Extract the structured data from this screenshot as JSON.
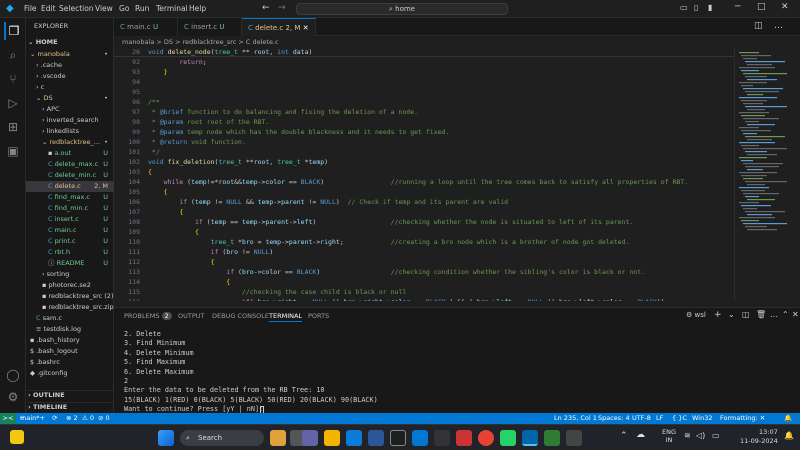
{
  "titlebar": {
    "menus": [
      "File",
      "Edit",
      "Selection",
      "View",
      "Go",
      "Run",
      "Terminal",
      "Help"
    ],
    "search_text": "home"
  },
  "explorer": {
    "header": "EXPLORER",
    "root": "HOME",
    "items": [
      {
        "label": "manobala",
        "badge": "•",
        "color": "#e2c08d"
      },
      {
        "label": ".cache",
        "badge": "",
        "color": "#ccc"
      },
      {
        "label": ".vscode",
        "badge": "",
        "color": "#ccc"
      },
      {
        "label": "c",
        "badge": "",
        "color": "#ccc"
      },
      {
        "label": "DS",
        "badge": "•",
        "color": "#e2c08d"
      },
      {
        "label": "APC",
        "badge": "",
        "color": "#ccc"
      },
      {
        "label": "inverted_search",
        "badge": "",
        "color": "#ccc"
      },
      {
        "label": "linkedlists",
        "badge": "",
        "color": "#ccc"
      },
      {
        "label": "redblacktree_...",
        "badge": "•",
        "color": "#e2c08d"
      },
      {
        "label": "a.out",
        "badge": "U",
        "color": "#73c991"
      },
      {
        "label": "delete_max.c",
        "badge": "U",
        "color": "#73c991"
      },
      {
        "label": "delete_min.c",
        "badge": "U",
        "color": "#73c991"
      },
      {
        "label": "delete.c",
        "badge": "2, M",
        "color": "#e2c08d"
      },
      {
        "label": "find_max.c",
        "badge": "U",
        "color": "#73c991"
      },
      {
        "label": "find_min.c",
        "badge": "U",
        "color": "#73c991"
      },
      {
        "label": "insert.c",
        "badge": "U",
        "color": "#73c991"
      },
      {
        "label": "main.c",
        "badge": "U",
        "color": "#73c991"
      },
      {
        "label": "print.c",
        "badge": "U",
        "color": "#73c991"
      },
      {
        "label": "rbt.h",
        "badge": "U",
        "color": "#73c991"
      },
      {
        "label": "README",
        "badge": "U",
        "color": "#73c991"
      },
      {
        "label": "sorting",
        "badge": "",
        "color": "#ccc"
      },
      {
        "label": "photorec.se2",
        "badge": "",
        "color": "#ccc"
      },
      {
        "label": "redblacktree_src (2)...",
        "badge": "",
        "color": "#ccc"
      },
      {
        "label": "redblacktree_src.zip",
        "badge": "",
        "color": "#ccc"
      },
      {
        "label": "sam.c",
        "badge": "",
        "color": "#ccc"
      },
      {
        "label": "testdisk.log",
        "badge": "",
        "color": "#ccc"
      },
      {
        "label": ".bash_history",
        "badge": "",
        "color": "#ccc"
      },
      {
        "label": ".bash_logout",
        "badge": "",
        "color": "#ccc"
      },
      {
        "label": ".bashrc",
        "badge": "",
        "color": "#ccc"
      },
      {
        "label": ".gitconfig",
        "badge": "",
        "color": "#ccc"
      }
    ],
    "outline": "OUTLINE",
    "timeline": "TIMELINE"
  },
  "tabs": [
    {
      "label": "main.c",
      "badge": "U",
      "active": false
    },
    {
      "label": "insert.c",
      "badge": "U",
      "active": false
    },
    {
      "label": "delete.c",
      "badge": "2, M",
      "active": true
    }
  ],
  "breadcrumb": "manobala > DS > redblacktree_src > C delete.c",
  "editor": {
    "sticky": {
      "ln": "26",
      "text": "void delete_node(tree_t ** root, int data)"
    },
    "lines": [
      {
        "ln": "92",
        "code": "        return;"
      },
      {
        "ln": "93",
        "code": "    }"
      },
      {
        "ln": "94",
        "code": ""
      },
      {
        "ln": "95",
        "code": ""
      },
      {
        "ln": "96",
        "code": "/**"
      },
      {
        "ln": "97",
        "code": " * @brief function to do balancing and fixing the deletion of a node."
      },
      {
        "ln": "98",
        "code": " * @param root root of the RBT."
      },
      {
        "ln": "99",
        "code": " * @param temp node which has the double blackness and it needs to get fixed."
      },
      {
        "ln": "100",
        "code": " * @return void function."
      },
      {
        "ln": "101",
        "code": " */"
      },
      {
        "ln": "102",
        "code": "void fix_deletion(tree_t **root, tree_t *temp)"
      },
      {
        "ln": "103",
        "code": "{"
      },
      {
        "ln": "104",
        "code": "    while (temp!=*root&&temp->color == BLACK)                 //running a loop until the tree comes back to satisfy all properties of RBT."
      },
      {
        "ln": "105",
        "code": "    {"
      },
      {
        "ln": "106",
        "code": "        if (temp != NULL && temp->parent != NULL)  // Check if temp and its parent are valid"
      },
      {
        "ln": "107",
        "code": "        {"
      },
      {
        "ln": "108",
        "code": "            if (temp == temp->parent->left)                   //checking whether the node is situated to left of its parent."
      },
      {
        "ln": "109",
        "code": "            {"
      },
      {
        "ln": "110",
        "code": "                tree_t *bro = temp->parent->right;            //creating a bro node which is a brother of node got deleted."
      },
      {
        "ln": "111",
        "code": "                if (bro != NULL)"
      },
      {
        "ln": "112",
        "code": "                {"
      },
      {
        "ln": "113",
        "code": "                    if (bro->color == BLACK)                  //checking condition whether the sibling's color is black or not."
      },
      {
        "ln": "114",
        "code": "                    {"
      },
      {
        "ln": "115",
        "code": "                        //checking the case child is black or null"
      },
      {
        "ln": "116",
        "code": "                        if( bro->right == NULL || bro->right->color == BLACK ) && ( bro->left == NULL || bro->left->color == BLACK))"
      }
    ]
  },
  "panel": {
    "tabs": [
      "PROBLEMS",
      "OUTPUT",
      "DEBUG CONSOLE",
      "TERMINAL",
      "PORTS"
    ],
    "problems_count": "2",
    "shell": "wsl",
    "terminal": [
      "2. Delete",
      "3. Find Minimum",
      "4. Delete Minimum",
      "5. Find Maximum",
      "6. Delete Maximum",
      "2",
      "Enter the data to be deleted from the RB Tree: 10",
      "15(BLACK) 1(RED) 0(BLACK) 5(BLACK) 50(RED) 20(BLACK) 90(BLACK)",
      "Want to continue? Press [yY | nN]: "
    ]
  },
  "status": {
    "remote": "><",
    "branch": "main*+",
    "sync": "⟳",
    "errors": "⊗ 2",
    "warnings": "⚠ 0",
    "ports": "⊘ 0",
    "position": "Ln 235, Col 1",
    "spaces": "Spaces: 4",
    "encoding": "UTF-8",
    "eol": "LF",
    "lang": "C",
    "platform": "Win32",
    "formatting": "Formatting: ✕",
    "bell": "🔔"
  },
  "taskbar": {
    "search": "Search",
    "lang1": "ENG",
    "lang2": "IN",
    "time": "13:07",
    "date": "11-09-2024"
  },
  "colors": {
    "accent": "#0078d4",
    "editor_bg": "#1f1f1f",
    "sidebar_bg": "#181818"
  }
}
